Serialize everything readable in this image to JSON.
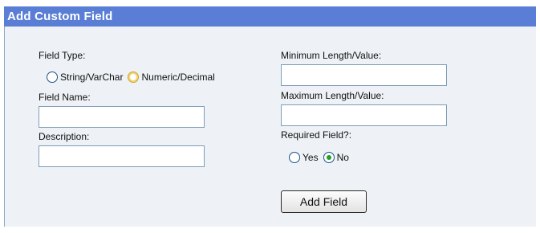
{
  "panel": {
    "title": "Add Custom Field"
  },
  "left": {
    "field_type_label": "Field Type:",
    "field_type_options": [
      {
        "label": "String/VarChar",
        "state": "unselected"
      },
      {
        "label": "Numeric/Decimal",
        "state": "hover"
      }
    ],
    "field_name_label": "Field Name:",
    "field_name_value": "",
    "description_label": "Description:",
    "description_value": ""
  },
  "right": {
    "min_label": "Minimum Length/Value:",
    "min_value": "",
    "max_label": "Maximum Length/Value:",
    "max_value": "",
    "required_label": "Required Field?:",
    "required_options": [
      {
        "label": "Yes",
        "state": "unselected"
      },
      {
        "label": "No",
        "state": "selected"
      }
    ],
    "add_button_label": "Add Field"
  },
  "colors": {
    "title_bar": "#5a7ed6",
    "panel_bg": "#eef2f6",
    "input_border": "#7f9db9",
    "radio_selected_dot": "#21a121"
  }
}
